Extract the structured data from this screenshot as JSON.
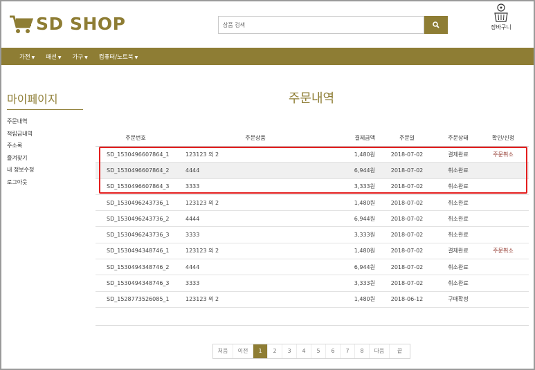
{
  "header": {
    "logo_text": "SD SHOP",
    "search_placeholder": "상품 검색",
    "basket_label": "장바구니"
  },
  "nav": {
    "items": [
      {
        "label": "가전"
      },
      {
        "label": "패션"
      },
      {
        "label": "가구"
      },
      {
        "label": "컴퓨터/노트북"
      }
    ]
  },
  "sidebar": {
    "title": "마이페이지",
    "items": [
      "주문내역",
      "적립금내역",
      "주소록",
      "즐겨찾기",
      "내 정보수정",
      "로그아웃"
    ]
  },
  "page_title": "주문내역",
  "table": {
    "headers": {
      "order_no": "주문번호",
      "product": "주문상품",
      "amount": "결제금액",
      "date": "주문일",
      "status": "주문상태",
      "action": "확인/신청"
    },
    "rows": [
      {
        "order_no": "SD_1530496607864_1",
        "product": "123123 외 2",
        "amount": "1,480원",
        "date": "2018-07-02",
        "status": "결제완료",
        "action": "주문취소"
      },
      {
        "order_no": "SD_1530496607864_2",
        "product": "4444",
        "amount": "6,944원",
        "date": "2018-07-02",
        "status": "취소완료",
        "action": ""
      },
      {
        "order_no": "SD_1530496607864_3",
        "product": "3333",
        "amount": "3,333원",
        "date": "2018-07-02",
        "status": "취소완료",
        "action": ""
      },
      {
        "order_no": "SD_1530496243736_1",
        "product": "123123 외 2",
        "amount": "1,480원",
        "date": "2018-07-02",
        "status": "취소완료",
        "action": ""
      },
      {
        "order_no": "SD_1530496243736_2",
        "product": "4444",
        "amount": "6,944원",
        "date": "2018-07-02",
        "status": "취소완료",
        "action": ""
      },
      {
        "order_no": "SD_1530496243736_3",
        "product": "3333",
        "amount": "3,333원",
        "date": "2018-07-02",
        "status": "취소완료",
        "action": ""
      },
      {
        "order_no": "SD_1530494348746_1",
        "product": "123123 외 2",
        "amount": "1,480원",
        "date": "2018-07-02",
        "status": "결제완료",
        "action": "주문취소"
      },
      {
        "order_no": "SD_1530494348746_2",
        "product": "4444",
        "amount": "6,944원",
        "date": "2018-07-02",
        "status": "취소완료",
        "action": ""
      },
      {
        "order_no": "SD_1530494348746_3",
        "product": "3333",
        "amount": "3,333원",
        "date": "2018-07-02",
        "status": "취소완료",
        "action": ""
      },
      {
        "order_no": "SD_1528773526085_1",
        "product": "123123 외 2",
        "amount": "1,480원",
        "date": "2018-06-12",
        "status": "구매확정",
        "action": ""
      }
    ]
  },
  "pagination": {
    "first": "처음",
    "prev": "이전",
    "pages": [
      "1",
      "2",
      "3",
      "4",
      "5",
      "6",
      "7",
      "8"
    ],
    "current": "1",
    "next": "다음",
    "last": "끝"
  },
  "colors": {
    "accent": "#8e7d34",
    "cancel_text": "#8b2a1f",
    "highlight_box": "#e31e1e"
  }
}
